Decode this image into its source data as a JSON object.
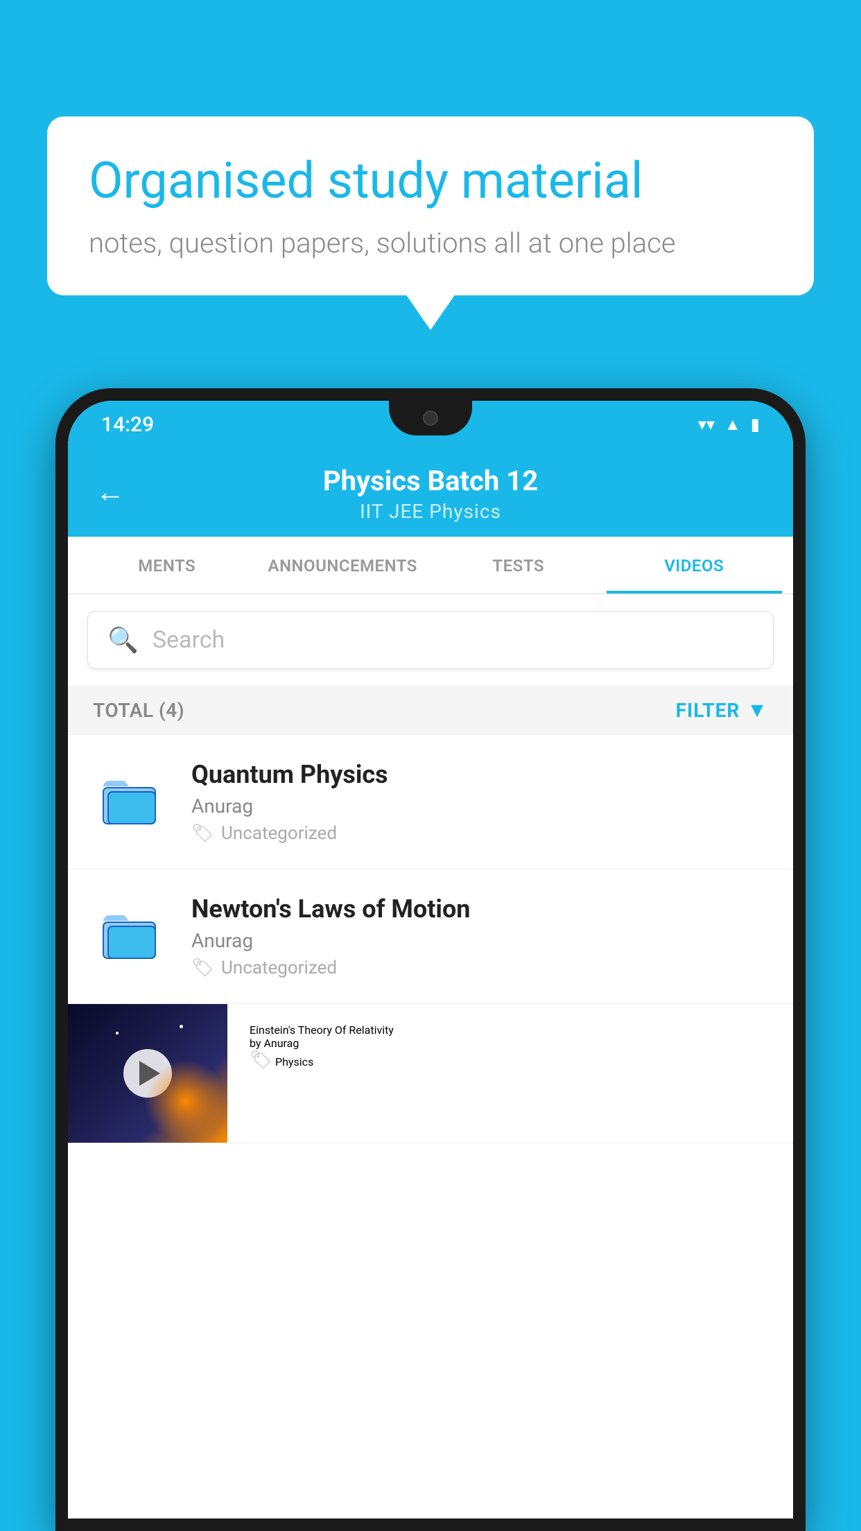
{
  "background_color": "#1ab8e8",
  "speech_bubble": {
    "heading": "Organised study material",
    "subtext": "notes, question papers, solutions all at one place"
  },
  "phone": {
    "status_bar": {
      "time": "14:29",
      "wifi_icon": "wifi",
      "signal_icon": "signal",
      "battery_icon": "battery"
    },
    "header": {
      "back_label": "←",
      "title": "Physics Batch 12",
      "subtitle": "IIT JEE   Physics"
    },
    "tabs": [
      {
        "label": "MENTS",
        "active": false
      },
      {
        "label": "ANNOUNCEMENTS",
        "active": false
      },
      {
        "label": "TESTS",
        "active": false
      },
      {
        "label": "VIDEOS",
        "active": true
      }
    ],
    "search": {
      "placeholder": "Search"
    },
    "filter_bar": {
      "total_label": "TOTAL (4)",
      "filter_label": "FILTER"
    },
    "videos": [
      {
        "title": "Quantum Physics",
        "author": "Anurag",
        "tag": "Uncategorized",
        "type": "folder"
      },
      {
        "title": "Newton's Laws of Motion",
        "author": "Anurag",
        "tag": "Uncategorized",
        "type": "folder"
      },
      {
        "title": "Einstein's Theory Of Relativity",
        "author": "by Anurag",
        "tag": "Physics",
        "type": "video"
      }
    ]
  }
}
